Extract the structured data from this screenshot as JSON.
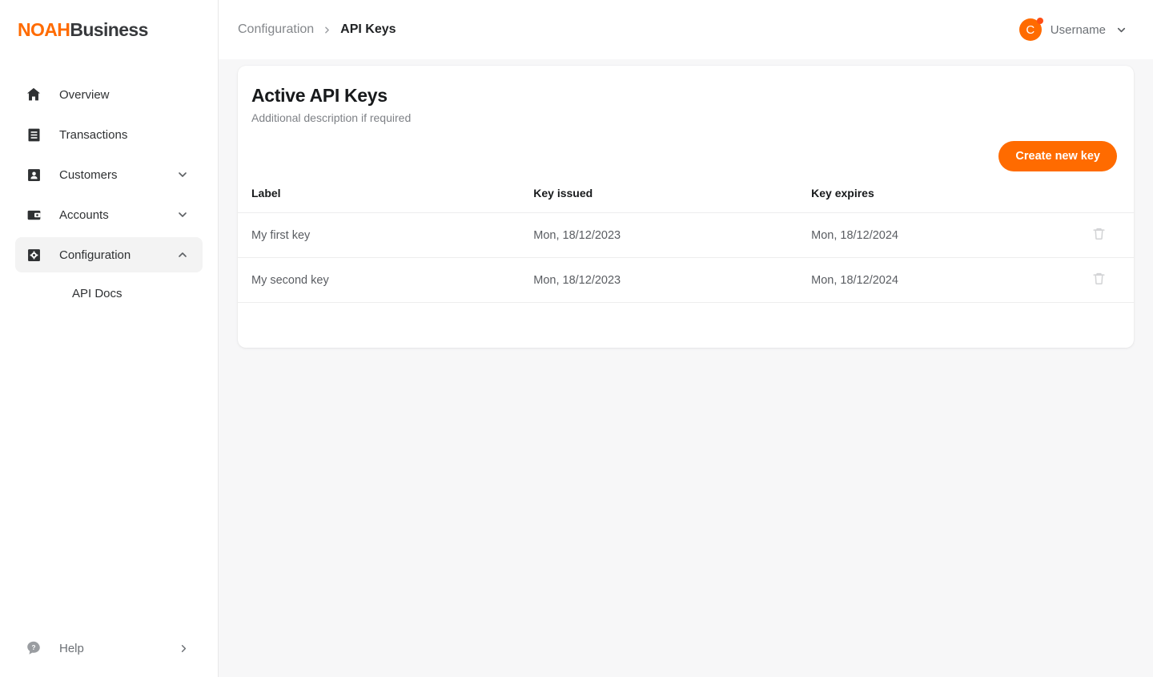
{
  "brand": {
    "primary": "NOAH",
    "secondary": "Business",
    "accent_color": "#FF6B00"
  },
  "sidebar": {
    "items": [
      {
        "label": "Overview",
        "icon": "home-icon",
        "expandable": false
      },
      {
        "label": "Transactions",
        "icon": "receipt-icon",
        "expandable": false
      },
      {
        "label": "Customers",
        "icon": "person-card-icon",
        "expandable": true,
        "expanded": false
      },
      {
        "label": "Accounts",
        "icon": "wallet-icon",
        "expandable": true,
        "expanded": false
      },
      {
        "label": "Configuration",
        "icon": "gear-box-icon",
        "expandable": true,
        "expanded": true,
        "active": true
      }
    ],
    "sub_items": [
      {
        "parent": "Configuration",
        "label": "API Docs"
      }
    ],
    "footer": {
      "label": "Help",
      "icon": "help-bubble-icon"
    }
  },
  "topbar": {
    "breadcrumb": {
      "parent": "Configuration",
      "separator": "›",
      "current": "API Keys"
    },
    "user": {
      "initial": "C",
      "name": "Username",
      "has_notification": true,
      "avatar_color": "#FF6B00",
      "dot_color": "#FF4D14"
    }
  },
  "card": {
    "title": "Active API Keys",
    "description": "Additional description if required",
    "create_button": "Create new key",
    "table": {
      "columns": [
        "Label",
        "Key issued",
        "Key expires"
      ],
      "rows": [
        {
          "label": "My first key",
          "issued": "Mon, 18/12/2023",
          "expires": "Mon, 18/12/2024",
          "delete_icon": "trash-icon"
        },
        {
          "label": "My second key",
          "issued": "Mon, 18/12/2023",
          "expires": "Mon, 18/12/2024",
          "delete_icon": "trash-icon"
        }
      ]
    }
  }
}
